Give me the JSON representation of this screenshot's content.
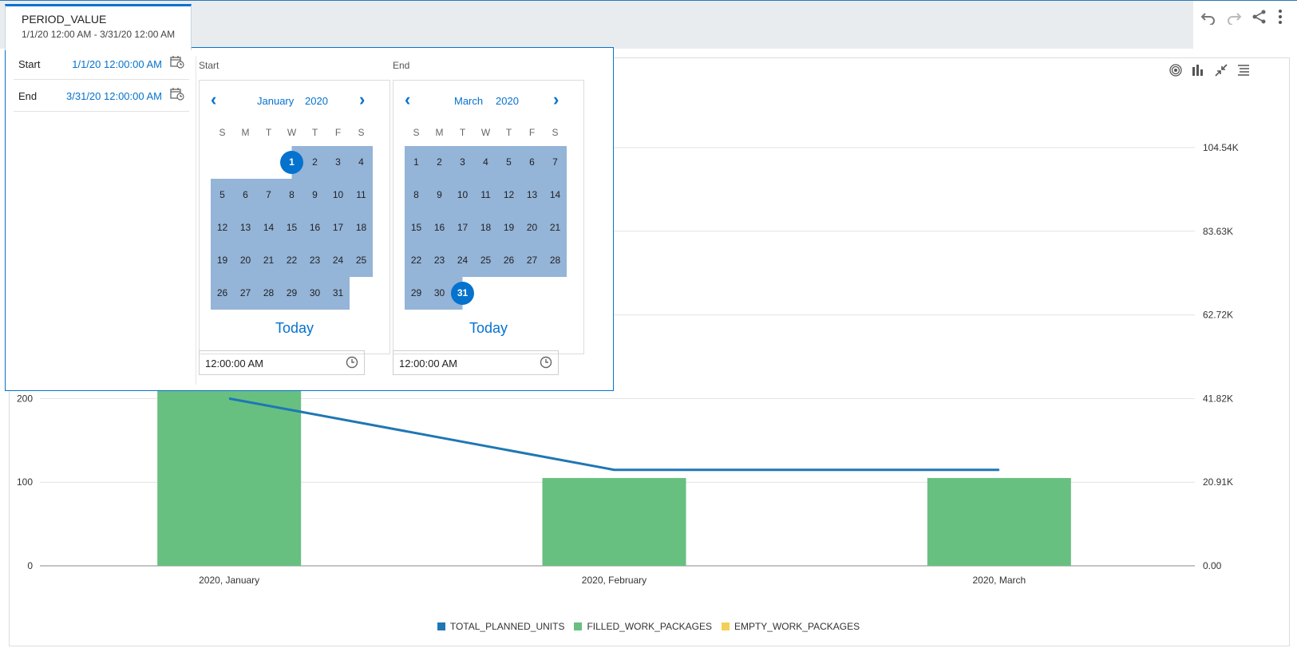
{
  "filter": {
    "name": "PERIOD_VALUE",
    "range": "1/1/20 12:00 AM - 3/31/20 12:00 AM"
  },
  "toolbar": {
    "undo_icon": "undo-icon",
    "redo_icon": "redo-icon",
    "share_icon": "share-icon",
    "more_icon": "more-vertical-icon"
  },
  "popup": {
    "start_label": "Start",
    "start_value": "1/1/20 12:00:00 AM",
    "end_label": "End",
    "end_value": "3/31/20 12:00:00 AM",
    "start_cal": {
      "header": "Start",
      "month": "January",
      "year": "2020",
      "today": "Today",
      "time": "12:00:00 AM",
      "weekdays": [
        "S",
        "M",
        "T",
        "W",
        "T",
        "F",
        "S"
      ],
      "first_weekday": 3,
      "days": 31,
      "selected_day": 1,
      "range_from": 1,
      "range_to": 31
    },
    "end_cal": {
      "header": "End",
      "month": "March",
      "year": "2020",
      "today": "Today",
      "time": "12:00:00 AM",
      "weekdays": [
        "S",
        "M",
        "T",
        "W",
        "T",
        "F",
        "S"
      ],
      "first_weekday": 0,
      "days": 31,
      "selected_day": 31,
      "range_from": 1,
      "range_to": 31
    }
  },
  "chart_tools": [
    "target-icon",
    "bar-chart-icon",
    "collapse-icon",
    "list-icon"
  ],
  "chart_data": {
    "type": "bar",
    "categories": [
      "2020, January",
      "2020, February",
      "2020, March"
    ],
    "series": [
      {
        "name": "TOTAL_PLANNED_UNITS",
        "type": "line",
        "axis": "right",
        "color": "#1f77b4",
        "values": [
          41820,
          24000,
          24000
        ]
      },
      {
        "name": "FILLED_WORK_PACKAGES",
        "type": "bar",
        "axis": "left",
        "color": "#67c080",
        "values": [
          232,
          105,
          105
        ]
      },
      {
        "name": "EMPTY_WORK_PACKAGES",
        "type": "bar",
        "axis": "left",
        "color": "#f5cf55",
        "values": [
          0,
          0,
          0
        ]
      }
    ],
    "y_left": {
      "ticks": [
        "0",
        "100",
        "200"
      ],
      "ylim": [
        0,
        500
      ]
    },
    "y_right": {
      "ticks": [
        "0.00",
        "20.91K",
        "41.82K",
        "62.72K",
        "83.63K",
        "104.54K"
      ],
      "ylim": [
        0,
        104540
      ]
    },
    "grid": true,
    "legend_position": "bottom"
  }
}
